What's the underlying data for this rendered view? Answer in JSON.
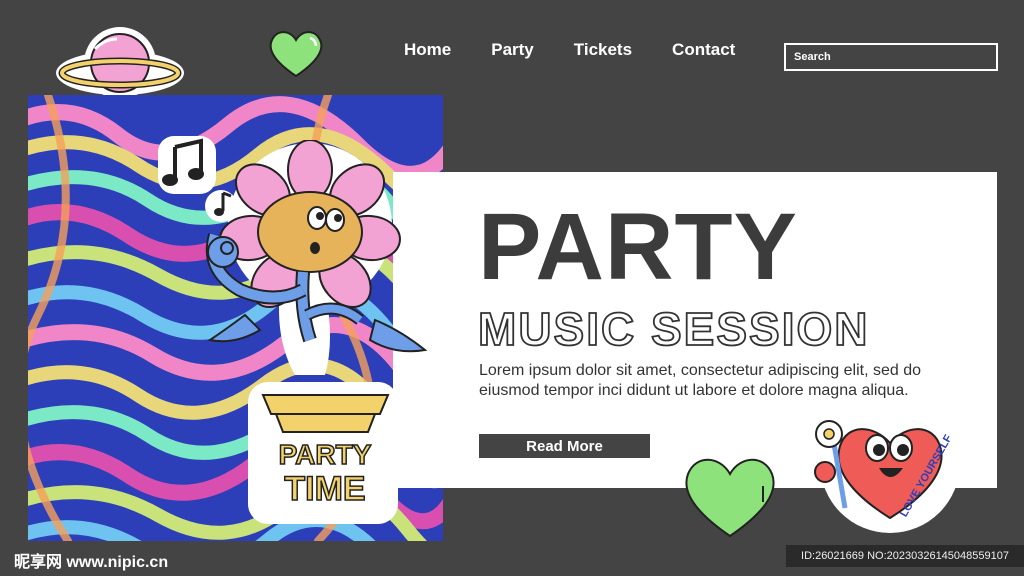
{
  "nav": {
    "items": [
      {
        "label": "Home"
      },
      {
        "label": "Party"
      },
      {
        "label": "Tickets"
      },
      {
        "label": "Contact"
      }
    ],
    "search_placeholder": "Search"
  },
  "hero": {
    "title": "PARTY",
    "subtitle": "MUSIC SESSION",
    "body": "Lorem ipsum dolor sit amet, consectetur adipiscing elit, sed do eiusmod tempor inci didunt ut labore et dolore magna aliqua.",
    "button_label": "Read More"
  },
  "stickers": {
    "party_time_line1": "PARTY",
    "party_time_line2": "TIME",
    "love_yourself": "LOVE YOURSELF"
  },
  "watermark": {
    "site": "昵享网 www.nipic.cn",
    "id_text": "ID:26021669 NO:20230326145048559107"
  },
  "colors": {
    "background": "#444444",
    "card": "#ffffff",
    "accent_green": "#8de27c",
    "accent_pink": "#f3a2d4",
    "accent_yellow": "#f4d26b",
    "heart_red": "#ef5b57"
  }
}
